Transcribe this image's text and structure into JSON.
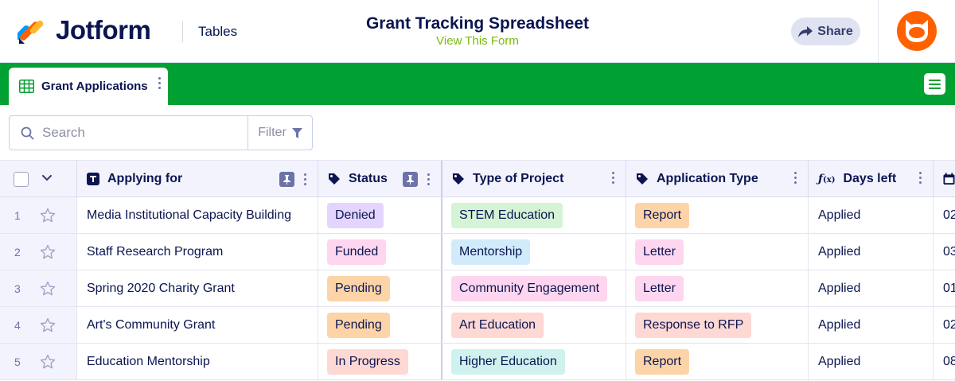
{
  "header": {
    "brand": "Jotform",
    "section": "Tables",
    "title": "Grant Tracking Spreadsheet",
    "view_form": "View This Form",
    "share_label": "Share"
  },
  "tabs": [
    {
      "label": "Grant Applications"
    }
  ],
  "search": {
    "placeholder": "Search",
    "filter_label": "Filter"
  },
  "colors": {
    "brand_green": "#01a032",
    "link_green": "#78bb07",
    "navy": "#0a1551",
    "avatar_orange": "#ff6100"
  },
  "columns": [
    {
      "label": "Applying for",
      "icon": "text-type-icon"
    },
    {
      "label": "Status",
      "icon": "tag-icon"
    },
    {
      "label": "Type of Project",
      "icon": "tag-icon"
    },
    {
      "label": "Application Type",
      "icon": "tag-icon"
    },
    {
      "label": "Days left",
      "icon": "formula-icon"
    }
  ],
  "rows": [
    {
      "num": "1",
      "applying_for": "Media Institutional Capacity Building",
      "status": "Denied",
      "status_color": "#e3d5fd",
      "project": "STEM Education",
      "project_color": "#d4f4d5",
      "app_type": "Report",
      "app_type_color": "#fdd4a7",
      "days_left": "Applied",
      "date": "02"
    },
    {
      "num": "2",
      "applying_for": "Staff Research Program",
      "status": "Funded",
      "status_color": "#fed6ef",
      "project": "Mentorship",
      "project_color": "#d2ebfb",
      "app_type": "Letter",
      "app_type_color": "#fed6ef",
      "days_left": "Applied",
      "date": "03"
    },
    {
      "num": "3",
      "applying_for": "Spring 2020 Charity Grant",
      "status": "Pending",
      "status_color": "#fdd4a7",
      "project": "Community Engagement",
      "project_color": "#fed6ef",
      "app_type": "Letter",
      "app_type_color": "#fed6ef",
      "days_left": "Applied",
      "date": "01"
    },
    {
      "num": "4",
      "applying_for": "Art's Community Grant",
      "status": "Pending",
      "status_color": "#fdd4a7",
      "project": "Art Education",
      "project_color": "#fed8d3",
      "app_type": "Response to RFP",
      "app_type_color": "#fed8d3",
      "days_left": "Applied",
      "date": "02"
    },
    {
      "num": "5",
      "applying_for": "Education Mentorship",
      "status": "In Progress",
      "status_color": "#fed8d3",
      "project": "Higher Education",
      "project_color": "#cff2ee",
      "app_type": "Report",
      "app_type_color": "#fdd4a7",
      "days_left": "Applied",
      "date": "08"
    }
  ]
}
